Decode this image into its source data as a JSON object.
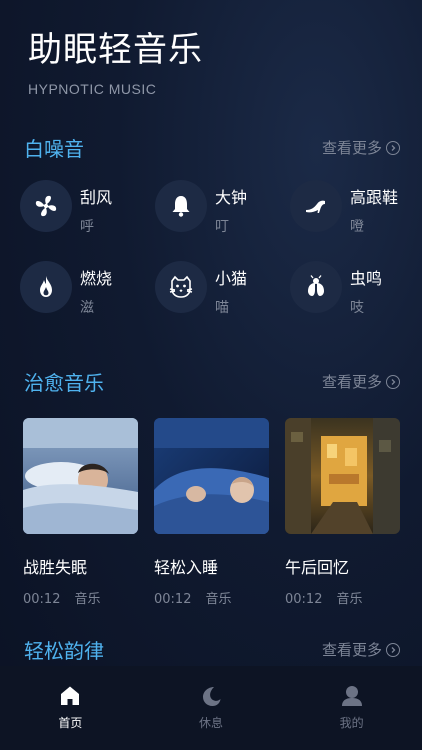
{
  "header": {
    "title": "助眠轻音乐",
    "subtitle": "HYPNOTIC MUSIC"
  },
  "white_noise": {
    "title": "白噪音",
    "more": "查看更多",
    "items": [
      {
        "name": "刮风",
        "sub": "呼",
        "icon": "fan-icon"
      },
      {
        "name": "大钟",
        "sub": "叮",
        "icon": "bell-icon"
      },
      {
        "name": "高跟鞋",
        "sub": "噔",
        "icon": "high-heel-icon"
      },
      {
        "name": "燃烧",
        "sub": "滋",
        "icon": "flame-icon"
      },
      {
        "name": "小猫",
        "sub": "喵",
        "icon": "cat-icon"
      },
      {
        "name": "虫鸣",
        "sub": "吱",
        "icon": "cicada-icon"
      }
    ]
  },
  "healing_music": {
    "title": "治愈音乐",
    "more": "查看更多",
    "cards": [
      {
        "title": "战胜失眠",
        "duration": "00:12",
        "tag": "音乐"
      },
      {
        "title": "轻松入睡",
        "duration": "00:12",
        "tag": "音乐"
      },
      {
        "title": "午后回忆",
        "duration": "00:12",
        "tag": "音乐"
      }
    ]
  },
  "relaxing_rhythm": {
    "title": "轻松韵律",
    "more": "查看更多"
  },
  "tabbar": {
    "tabs": [
      {
        "label": "首页",
        "icon": "home-icon",
        "active": true
      },
      {
        "label": "休息",
        "icon": "moon-icon",
        "active": false
      },
      {
        "label": "我的",
        "icon": "user-icon",
        "active": false
      }
    ]
  },
  "colors": {
    "accent": "#4fb2ee",
    "background": "#0f182c",
    "icon_bg": "#1d2a44",
    "muted": "#7d8596"
  }
}
